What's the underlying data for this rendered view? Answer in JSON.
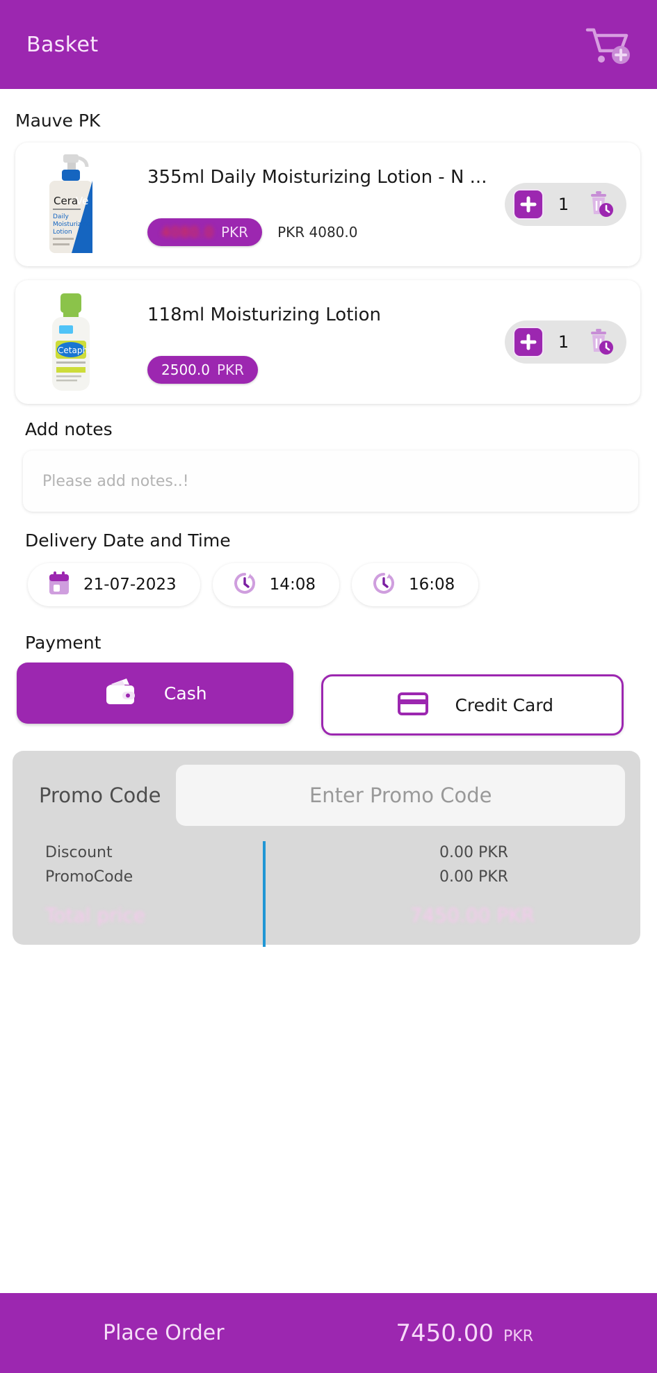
{
  "header": {
    "title": "Basket",
    "cart_icon": "cart-plus-icon"
  },
  "store": {
    "name": "Mauve PK"
  },
  "products": [
    {
      "title": "355ml Daily Moisturizing Lotion - N ...",
      "price_value": "4080.0",
      "price_currency": "PKR",
      "price_redacted": true,
      "original_price": "PKR 4080.0",
      "quantity": "1",
      "image": "cerave-daily-moisturizing-lotion-bottle",
      "plus_icon": "plus-icon",
      "delete_icon": "trash-clock-icon"
    },
    {
      "title": "118ml Moisturizing Lotion",
      "price_value": "2500.0",
      "price_currency": "PKR",
      "price_redacted": false,
      "original_price": "",
      "quantity": "1",
      "image": "cetaphil-moisturizing-lotion-bottle",
      "plus_icon": "plus-icon",
      "delete_icon": "trash-clock-icon"
    }
  ],
  "notes": {
    "label": "Add notes",
    "placeholder": "Please add notes..!",
    "value": ""
  },
  "delivery": {
    "label": "Delivery Date and Time",
    "chips": [
      {
        "icon": "calendar-icon",
        "value": "21-07-2023"
      },
      {
        "icon": "clock-icon",
        "value": "14:08"
      },
      {
        "icon": "clock-icon",
        "value": "16:08"
      }
    ]
  },
  "payment": {
    "label": "Payment",
    "options": [
      {
        "label": "Cash",
        "icon": "wallet-icon",
        "selected": true
      },
      {
        "label": "Credit Card",
        "icon": "credit-card-icon",
        "selected": false
      }
    ]
  },
  "summary": {
    "promo_label": "Promo Code",
    "promo_placeholder": "Enter Promo Code",
    "promo_value": "",
    "rows": [
      {
        "key": "Discount",
        "value": "0.00 PKR"
      },
      {
        "key": "PromoCode",
        "value": "0.00 PKR"
      }
    ],
    "total_key": "Total price",
    "total_value": "7450.00 PKR"
  },
  "bottom": {
    "place_order": "Place Order",
    "total_amount": "7450.00",
    "total_currency": "PKR"
  },
  "colors": {
    "brand_purple": "#9c27b0",
    "divider_blue": "#2196d4",
    "chip_grey": "#e4e4e4",
    "summary_grey": "#d9d9d9"
  }
}
